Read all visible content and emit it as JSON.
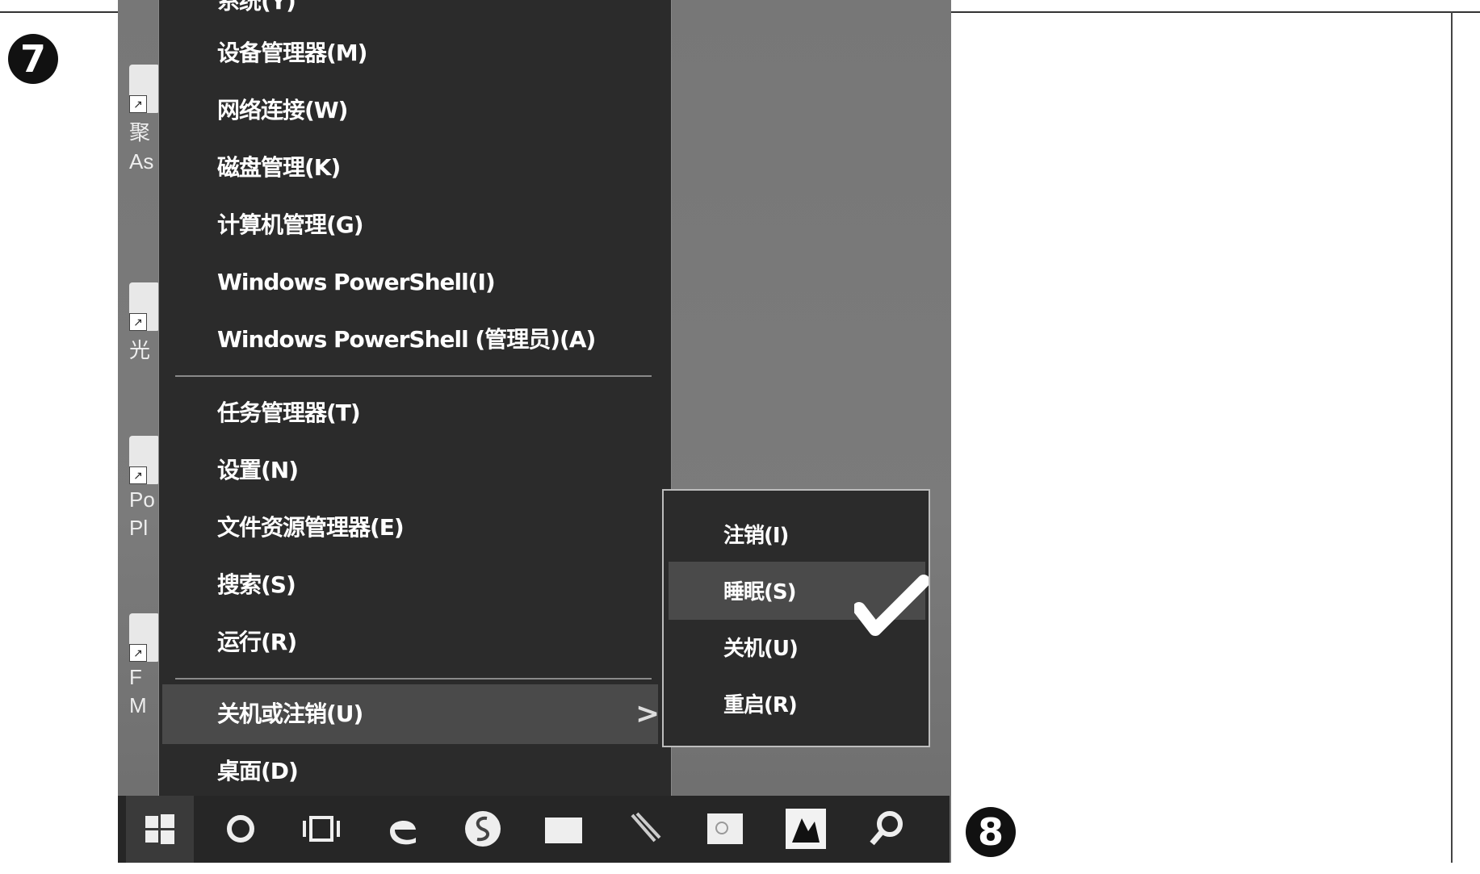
{
  "markers": {
    "top_left": "7",
    "bottom_right": "8"
  },
  "desktop": {
    "icons": [
      {
        "label_line1": "聚",
        "label_line2": "As"
      },
      {
        "label_line1": "光",
        "label_line2": ""
      },
      {
        "label_line1": "Po",
        "label_line2": "Pl"
      },
      {
        "label_line1": "F",
        "label_line2": "M"
      }
    ]
  },
  "menu": {
    "items": [
      {
        "label": "系统(Y)"
      },
      {
        "label": "设备管理器(M)"
      },
      {
        "label": "网络连接(W)"
      },
      {
        "label": "磁盘管理(K)"
      },
      {
        "label": "计算机管理(G)"
      },
      {
        "label": "Windows PowerShell(I)"
      },
      {
        "label": "Windows PowerShell (管理员)(A)"
      },
      {
        "label": "任务管理器(T)"
      },
      {
        "label": "设置(N)"
      },
      {
        "label": "文件资源管理器(E)"
      },
      {
        "label": "搜索(S)"
      },
      {
        "label": "运行(R)"
      },
      {
        "label": "关机或注销(U)",
        "chevron": ">"
      },
      {
        "label": "桌面(D)"
      }
    ]
  },
  "submenu": {
    "items": [
      {
        "label": "注销(I)"
      },
      {
        "label": "睡眠(S)"
      },
      {
        "label": "关机(U)"
      },
      {
        "label": "重启(R)"
      }
    ]
  },
  "taskbar": {
    "buttons": [
      {
        "icon": "windows-start-icon"
      },
      {
        "icon": "cortana-circle-icon"
      },
      {
        "icon": "task-view-icon"
      },
      {
        "icon": "edge-browser-icon"
      },
      {
        "icon": "sogou-icon"
      },
      {
        "icon": "folder-icon"
      },
      {
        "icon": "paperclip-icon"
      },
      {
        "icon": "photo-icon"
      },
      {
        "icon": "app-icon"
      },
      {
        "icon": "search-icon"
      }
    ]
  },
  "colors": {
    "menu_bg": "#2b2b2b",
    "highlight": "#4a4a4a",
    "taskbar": "#262626"
  }
}
